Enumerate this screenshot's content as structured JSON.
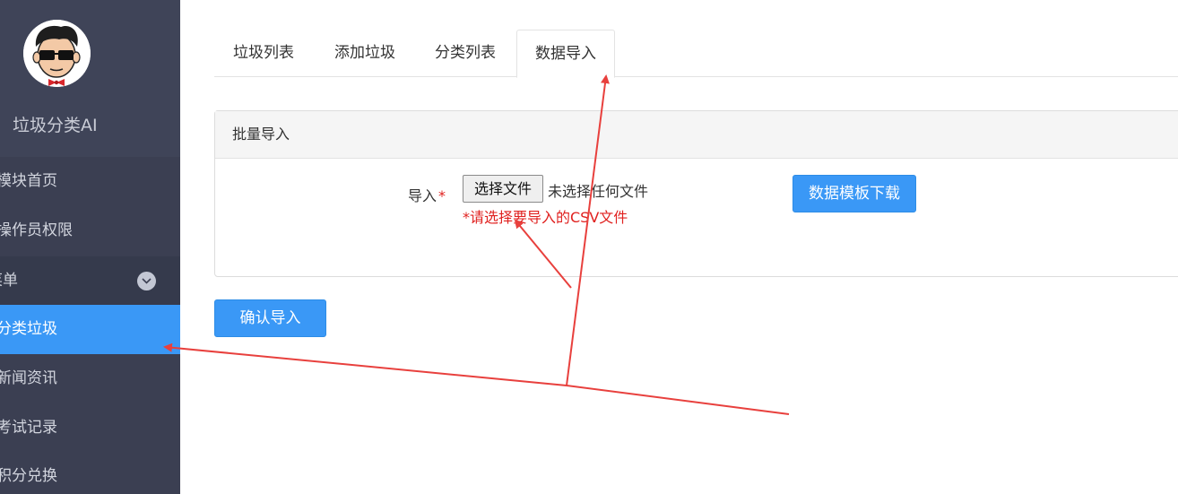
{
  "sidebar": {
    "brand_title": "垃圾分类AI",
    "items": [
      {
        "label": "模块首页"
      },
      {
        "label": "操作员权限"
      },
      {
        "label": "菜单"
      },
      {
        "label": "分类垃圾"
      },
      {
        "label": "新闻资讯"
      },
      {
        "label": "考试记录"
      },
      {
        "label": "积分兑换"
      }
    ]
  },
  "tabs": [
    {
      "label": "垃圾列表"
    },
    {
      "label": "添加垃圾"
    },
    {
      "label": "分类列表"
    },
    {
      "label": "数据导入",
      "active": true
    }
  ],
  "panel": {
    "title": "批量导入",
    "import_label": "导入",
    "required_mark": "*",
    "file_button": "选择文件",
    "file_status": "未选择任何文件",
    "hint": "*请选择要导入的CSV文件",
    "download_button": "数据模板下载"
  },
  "confirm_button": "确认导入",
  "colors": {
    "sidebar_bg": "#3b3f52",
    "active_bg": "#3a98f6",
    "primary": "#3a98f6",
    "required": "#e0211f",
    "annotation_arrow": "#e8403d"
  }
}
